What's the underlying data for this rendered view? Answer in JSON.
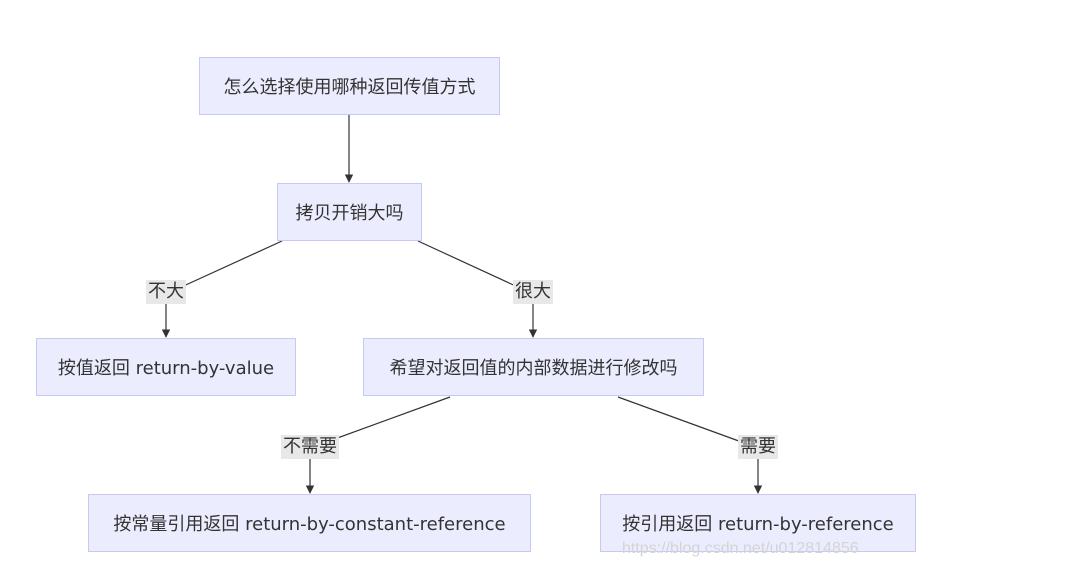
{
  "nodes": {
    "root": "怎么选择使用哪种返回传值方式",
    "copy_cost": "拷贝开销大吗",
    "by_value": "按值返回 return-by-value",
    "modify": "希望对返回值的内部数据进行修改吗",
    "by_const_ref": "按常量引用返回 return-by-constant-reference",
    "by_ref": "按引用返回 return-by-reference"
  },
  "edges": {
    "not_big": "不大",
    "very_big": "很大",
    "no_need": "不需要",
    "need": "需要"
  },
  "watermark": "https://blog.csdn.net/u012814856",
  "colors": {
    "node_fill": "#ececff",
    "node_border": "#c8c8f5",
    "edge_line": "#333333",
    "label_bg": "#e8e8e8",
    "text": "#333333"
  }
}
